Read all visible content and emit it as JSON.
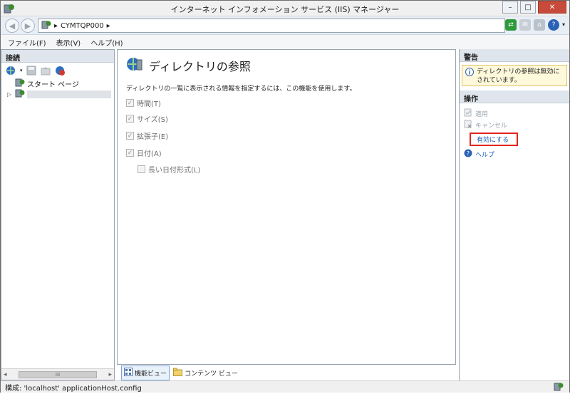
{
  "window": {
    "title": "インターネット インフォメーション サービス (IIS) マネージャー",
    "minimize_label": "–",
    "restore_label": "□",
    "close_label": "✕"
  },
  "address": {
    "path_separator": "▸",
    "server": "CYMTQP000",
    "trailing_separator": "▸"
  },
  "menu": {
    "items": [
      "ファイル(F)",
      "表示(V)",
      "ヘルプ(H)"
    ]
  },
  "connections": {
    "header": "接続",
    "tree": {
      "start_page": "スタート ページ",
      "server_node_label": ""
    },
    "scroll_left": "◂",
    "scroll_right": "▸",
    "scroll_thumb": "III"
  },
  "feature": {
    "title": "ディレクトリの参照",
    "description": "ディレクトリの一覧に表示される情報を指定するには、この機能を使用します。",
    "options": [
      {
        "label": "時間(T)",
        "checked": true
      },
      {
        "label": "サイズ(S)",
        "checked": true
      },
      {
        "label": "拡張子(E)",
        "checked": true
      },
      {
        "label": "日付(A)",
        "checked": true
      },
      {
        "label": "長い日付形式(L)",
        "checked": false
      }
    ],
    "check_glyph": "✓"
  },
  "view_tabs": {
    "features": "機能ビュー",
    "content": "コンテンツ ビュー"
  },
  "actions": {
    "alerts_header": "警告",
    "alert_text": "ディレクトリの参照は無効にされています。",
    "actions_header": "操作",
    "apply": "適用",
    "cancel": "キャンセル",
    "enable": "有効にする",
    "help": "ヘルプ"
  },
  "status": {
    "text": "構成: 'localhost' applicationHost.config"
  },
  "colors": {
    "highlight_box": "#e1251b",
    "link": "#1b5fb5",
    "disabled": "#9aa3ad"
  }
}
